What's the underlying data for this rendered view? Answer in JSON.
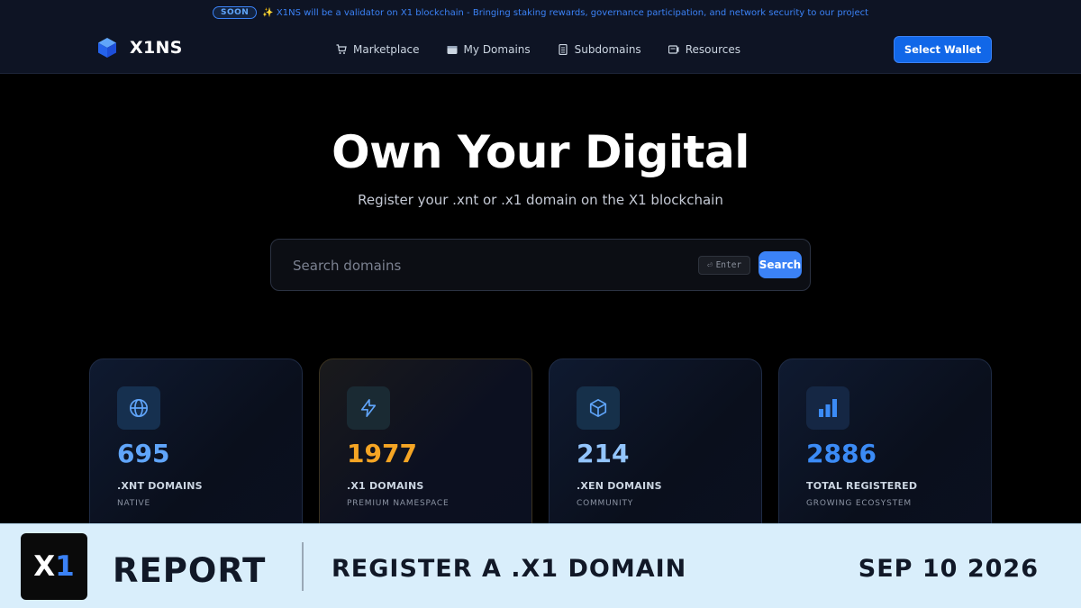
{
  "announcement": {
    "badge": "SOON",
    "text": "✨ X1NS will be a validator on X1 blockchain - Bringing staking rewards, governance participation, and network security to our project"
  },
  "header": {
    "logo_text": "X1NS",
    "nav": [
      {
        "label": "Marketplace",
        "icon": "cart-icon"
      },
      {
        "label": "My Domains",
        "icon": "wallet-icon"
      },
      {
        "label": "Subdomains",
        "icon": "document-icon"
      },
      {
        "label": "Resources",
        "icon": "book-icon"
      }
    ],
    "wallet_button": "Select Wallet"
  },
  "hero": {
    "title": "Own Your Digital",
    "subtitle": "Register your .xnt or .x1 domain on the X1 blockchain"
  },
  "search": {
    "placeholder": "Search domains",
    "value": "",
    "enter_hint_glyph": "⏎",
    "enter_hint": "Enter",
    "button": "Search"
  },
  "stats": [
    {
      "value": "695",
      "label": ".XNT DOMAINS",
      "sub": "NATIVE",
      "icon": "globe-icon",
      "color": "#60a5fa",
      "icon_bg": "#16304f"
    },
    {
      "value": "1977",
      "label": ".X1 DOMAINS",
      "sub": "PREMIUM NAMESPACE",
      "icon": "lightning-icon",
      "color": "#f5a524",
      "icon_bg": "#1a2a33"
    },
    {
      "value": "214",
      "label": ".XEN DOMAINS",
      "sub": "COMMUNITY",
      "icon": "cube-icon",
      "color": "#93c5fd",
      "icon_bg": "#16304a"
    },
    {
      "value": "2886",
      "label": "TOTAL REGISTERED",
      "sub": "GROWING ECOSYSTEM",
      "icon": "bar-chart-icon",
      "color": "#3b8bf6",
      "icon_bg": "#152744"
    }
  ],
  "report": {
    "logo_x": "X",
    "logo_one": "1",
    "label": "REPORT",
    "title": "REGISTER A .X1 DOMAIN",
    "date": "SEP 10 2026"
  }
}
